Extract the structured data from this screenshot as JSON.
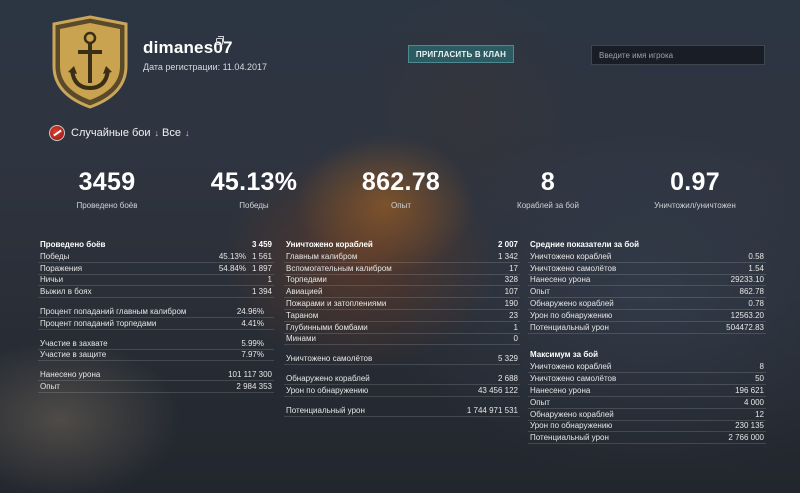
{
  "header": {
    "nickname": "dimanes07",
    "reg_date": "Дата регистрации: 11.04.2017",
    "invite_label": "ПРИГЛАСИТЬ В КЛАН",
    "search_placeholder": "Введите имя игрока"
  },
  "filters": {
    "mode_label": "Случайные бои",
    "class_label": "Все",
    "arrow": "↓"
  },
  "summary": [
    {
      "value": "3459",
      "label": "Проведено боёв"
    },
    {
      "value": "45.13%",
      "label": "Победы"
    },
    {
      "value": "862.78",
      "label": "Опыт"
    },
    {
      "value": "8",
      "label": "Кораблей за бой"
    },
    {
      "value": "0.97",
      "label": "Уничтожил/уничтожен"
    }
  ],
  "battles": {
    "title": "Проведено боёв",
    "total": "3 459",
    "group1": [
      {
        "label": "Победы",
        "pct": "45.13%",
        "value": "1 561"
      },
      {
        "label": "Поражения",
        "pct": "54.84%",
        "value": "1 897"
      },
      {
        "label": "Ничьи",
        "pct": "",
        "value": "1"
      },
      {
        "label": "Выжил в боях",
        "pct": "",
        "value": "1 394"
      }
    ],
    "group2": [
      {
        "label": "Процент попаданий главным калибром",
        "value": "24.96%"
      },
      {
        "label": "Процент попаданий торпедами",
        "value": "4.41%"
      }
    ],
    "group3": [
      {
        "label": "Участие в захвате",
        "value": "5.99%"
      },
      {
        "label": "Участие в защите",
        "value": "7.97%"
      }
    ],
    "group4": [
      {
        "label": "Нанесено урона",
        "value": "101 117 300"
      },
      {
        "label": "Опыт",
        "value": "2 984 353"
      }
    ]
  },
  "kills": {
    "title": "Уничтожено кораблей",
    "total": "2 007",
    "rows": [
      {
        "label": "Главным калибром",
        "value": "1 342"
      },
      {
        "label": "Вспомогательным калибром",
        "value": "17"
      },
      {
        "label": "Торпедами",
        "value": "328"
      },
      {
        "label": "Авиацией",
        "value": "107"
      },
      {
        "label": "Пожарами и затоплениями",
        "value": "190"
      },
      {
        "label": "Тараном",
        "value": "23"
      },
      {
        "label": "Глубинными бомбами",
        "value": "1"
      },
      {
        "label": "Минами",
        "value": "0"
      }
    ],
    "planes": {
      "label": "Уничтожено самолётов",
      "value": "5 329"
    },
    "spot": [
      {
        "label": "Обнаружено кораблей",
        "value": "2 688"
      },
      {
        "label": "Урон по обнаружению",
        "value": "43 456 122"
      }
    ],
    "potential": {
      "label": "Потенциальный урон",
      "value": "1 744 971 531"
    }
  },
  "averages": {
    "title": "Средние показатели за бой",
    "rows": [
      {
        "label": "Уничтожено кораблей",
        "value": "0.58"
      },
      {
        "label": "Уничтожено самолётов",
        "value": "1.54"
      },
      {
        "label": "Нанесено урона",
        "value": "29233.10"
      },
      {
        "label": "Опыт",
        "value": "862.78"
      },
      {
        "label": "Обнаружено кораблей",
        "value": "0.78"
      },
      {
        "label": "Урон по обнаружению",
        "value": "12563.20"
      },
      {
        "label": "Потенциальный урон",
        "value": "504472.83"
      }
    ]
  },
  "maximums": {
    "title": "Максимум за бой",
    "rows": [
      {
        "label": "Уничтожено кораблей",
        "value": "8"
      },
      {
        "label": "Уничтожено самолётов",
        "value": "50"
      },
      {
        "label": "Нанесено урона",
        "value": "196 621"
      },
      {
        "label": "Опыт",
        "value": "4 000"
      },
      {
        "label": "Обнаружено кораблей",
        "value": "12"
      },
      {
        "label": "Урон по обнаружению",
        "value": "230 135"
      },
      {
        "label": "Потенциальный урон",
        "value": "2 766 000"
      }
    ]
  }
}
